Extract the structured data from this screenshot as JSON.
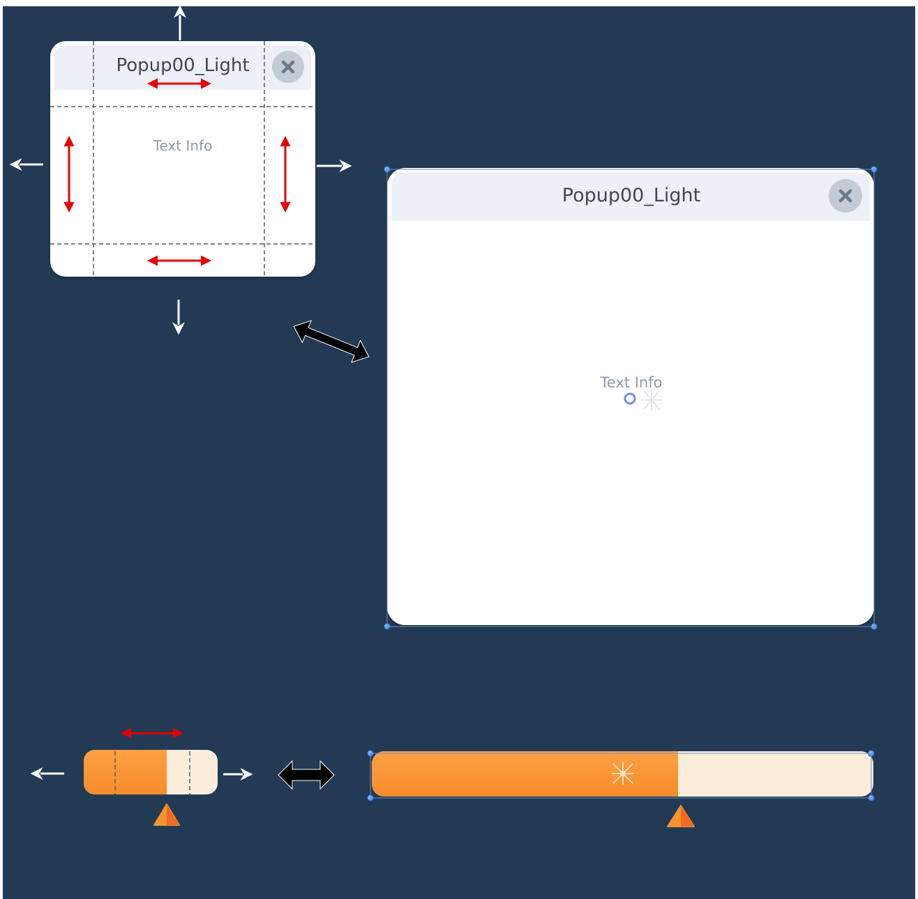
{
  "small_popup": {
    "title": "Popup00_Light",
    "body_text": "Text Info",
    "close_icon": "close-icon"
  },
  "large_popup": {
    "title": "Popup00_Light",
    "body_text": "Text Info",
    "close_icon": "close-icon"
  },
  "small_slider": {
    "fill_fraction": 0.62,
    "marker_icon": "triangle-marker-icon"
  },
  "large_slider": {
    "fill_fraction": 0.61,
    "marker_icon": "triangle-marker-icon"
  },
  "colors": {
    "background": "#233a55",
    "popup_header": "#eef0f7",
    "popup_body": "#ffffff",
    "slider_fill": "#f7932f",
    "slider_track": "#fdeedc",
    "guide_arrow": "#e60000",
    "direction_arrow": "#ffffff",
    "transform_arrow": "#000000",
    "selection_handle": "#2f6fd8"
  }
}
